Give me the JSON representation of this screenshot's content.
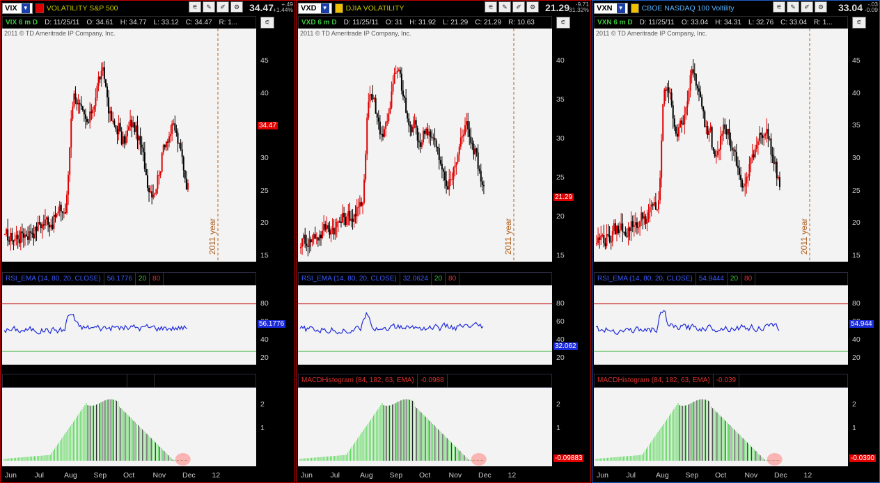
{
  "colors": {
    "up": "#e00000",
    "down": "#000000",
    "rsi": "#1e2ad8",
    "hi": "#c00000",
    "lo": "#22aa22",
    "macd_green": "#55d655"
  },
  "panels": [
    {
      "id": "vix",
      "border": "red",
      "symbol": "VIX",
      "description": "VOLATILITY S&P 500",
      "desc_color": "#c8c800",
      "price": "34.47",
      "change": "+.49",
      "change_pct": "+1.44%",
      "info": {
        "tsym": "VIX 6 m D",
        "d": "D: 11/25/11",
        "o": "O: 34.61",
        "h": "H: 34.77",
        "l": "L: 33.12",
        "c": "C: 34.47",
        "r": "R: 1..."
      },
      "copyright": "2011 © TD Ameritrade IP Company, Inc.",
      "year_label": "2011 year",
      "price_axis": [
        "45",
        "40",
        "35",
        "30",
        "25",
        "20",
        "15"
      ],
      "price_last": "34.47",
      "rsi": {
        "title": "RSI_EMA (14, 80, 20, CLOSE)",
        "value": "56.1776",
        "lo": "20",
        "hi": "80",
        "last": "56.1776",
        "axis": [
          "80",
          "60",
          "40",
          "20"
        ]
      },
      "macd": {
        "title": "",
        "value": "",
        "axis": [
          "2",
          "1"
        ],
        "last": ""
      },
      "xaxis": [
        "Jun",
        "Jul",
        "Aug",
        "Sep",
        "Oct",
        "Nov",
        "Dec",
        "12"
      ]
    },
    {
      "id": "vxd",
      "border": "red",
      "symbol": "VXD",
      "description": "DJIA VOLATILITY",
      "desc_color": "#c8c800",
      "price": "21.29",
      "change": "-9.71",
      "change_pct": "-31.32%",
      "info": {
        "tsym": "VXD 6 m D",
        "d": "D: 11/25/11",
        "o": "O: 31",
        "h": "H: 31.92",
        "l": "L: 21.29",
        "c": "C: 21.29",
        "r": "R: 10.63"
      },
      "copyright": "2011 © TD Ameritrade IP Company, Inc.",
      "year_label": "2011 year",
      "price_axis": [
        "40",
        "35",
        "30",
        "25",
        "20",
        "15"
      ],
      "price_last": "21.29",
      "rsi": {
        "title": "RSI_EMA (14, 80, 20, CLOSE)",
        "value": "32.0624",
        "lo": "20",
        "hi": "80",
        "last": "32.062",
        "axis": [
          "80",
          "60",
          "40",
          "20"
        ]
      },
      "macd": {
        "title": "MACDHistogram (84, 182, 63, EMA)",
        "value": "-0.0988",
        "axis": [
          "2",
          "1"
        ],
        "last": "-0.09883"
      },
      "xaxis": [
        "Jun",
        "Jul",
        "Aug",
        "Sep",
        "Oct",
        "Nov",
        "Dec",
        "12"
      ]
    },
    {
      "id": "vxn",
      "border": "blue",
      "symbol": "VXN",
      "description": "CBOE NASDAQ 100 Voltility",
      "desc_color": "#5ab4ff",
      "price": "33.04",
      "change": "-.03",
      "change_pct": "-0.09",
      "info": {
        "tsym": "VXN 6 m D",
        "d": "D: 11/25/11",
        "o": "O: 33.04",
        "h": "H: 34.31",
        "l": "L: 32.76",
        "c": "C: 33.04",
        "r": "R: 1..."
      },
      "copyright": "2011 © TD Ameritrade IP Company, Inc.",
      "year_label": "2011 year",
      "price_axis": [
        "45",
        "40",
        "35",
        "30",
        "25",
        "20",
        "15"
      ],
      "price_last": "",
      "rsi": {
        "title": "RSI_EMA (14, 80, 20, CLOSE)",
        "value": "54.9444",
        "lo": "20",
        "hi": "80",
        "last": "54.944",
        "axis": [
          "80",
          "60",
          "40",
          "20"
        ]
      },
      "macd": {
        "title": "MACDHistogram (84, 182, 63, EMA)",
        "value": "-0.039",
        "axis": [
          "2",
          "1"
        ],
        "last": "-0.0390"
      },
      "xaxis": [
        "Jun",
        "Jul",
        "Aug",
        "Sep",
        "Oct",
        "Nov",
        "Dec",
        "12"
      ]
    }
  ]
}
